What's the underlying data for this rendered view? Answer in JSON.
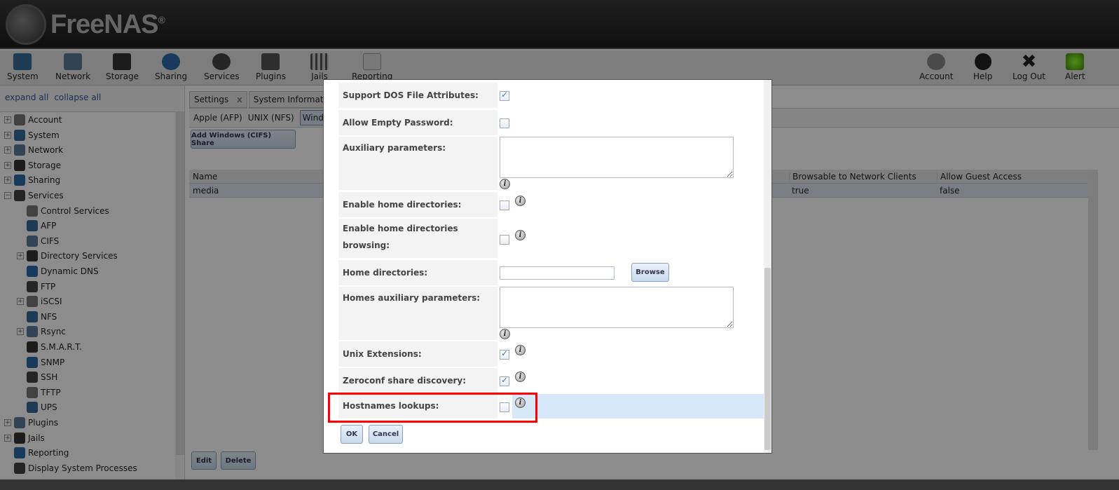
{
  "header": {
    "logo": "FreeNAS"
  },
  "toolbar": {
    "left": [
      "System",
      "Network",
      "Storage",
      "Sharing",
      "Services",
      "Plugins",
      "Jails",
      "Reporting"
    ],
    "right": [
      "Account",
      "Help",
      "Log Out",
      "Alert"
    ]
  },
  "sidebar": {
    "expand_all": "expand all",
    "collapse_all": "collapse all",
    "items": [
      {
        "label": "Account",
        "level": 0,
        "exp": true
      },
      {
        "label": "System",
        "level": 0,
        "exp": true
      },
      {
        "label": "Network",
        "level": 0,
        "exp": true
      },
      {
        "label": "Storage",
        "level": 0,
        "exp": true
      },
      {
        "label": "Sharing",
        "level": 0,
        "exp": true
      },
      {
        "label": "Services",
        "level": 0,
        "exp": true,
        "open": true
      },
      {
        "label": "Control Services",
        "level": 1
      },
      {
        "label": "AFP",
        "level": 1
      },
      {
        "label": "CIFS",
        "level": 1
      },
      {
        "label": "Directory Services",
        "level": 1,
        "exp": true
      },
      {
        "label": "Dynamic DNS",
        "level": 1
      },
      {
        "label": "FTP",
        "level": 1
      },
      {
        "label": "iSCSI",
        "level": 1,
        "exp": true
      },
      {
        "label": "NFS",
        "level": 1
      },
      {
        "label": "Rsync",
        "level": 1,
        "exp": true
      },
      {
        "label": "S.M.A.R.T.",
        "level": 1
      },
      {
        "label": "SNMP",
        "level": 1
      },
      {
        "label": "SSH",
        "level": 1
      },
      {
        "label": "TFTP",
        "level": 1
      },
      {
        "label": "UPS",
        "level": 1
      },
      {
        "label": "Plugins",
        "level": 0,
        "exp": true
      },
      {
        "label": "Jails",
        "level": 0,
        "exp": true
      },
      {
        "label": "Reporting",
        "level": 0
      },
      {
        "label": "Display System Processes",
        "level": 0
      }
    ]
  },
  "main": {
    "tabs": [
      "Settings",
      "System Information"
    ],
    "tab_close": "x",
    "subtabs": [
      "Apple (AFP)",
      "UNIX (NFS)",
      "Windows"
    ],
    "add_button": "Add Windows (CIFS) Share",
    "columns": [
      "Name",
      "Browsable to Network Clients",
      "Allow Guest Access"
    ],
    "rows": [
      [
        "media",
        "true",
        "false"
      ]
    ],
    "edit": "Edit",
    "delete": "Delete"
  },
  "dialog": {
    "support_dos": {
      "label": "Support DOS File Attributes:",
      "checked": true
    },
    "allow_empty": {
      "label": "Allow Empty Password:",
      "checked": false
    },
    "aux": {
      "label": "Auxiliary parameters:",
      "value": ""
    },
    "home_enable": {
      "label": "Enable home directories:",
      "checked": false
    },
    "home_browse": {
      "label": "Enable home directories browsing:",
      "checked": false
    },
    "home_dir": {
      "label": "Home directories:",
      "value": "",
      "browse": "Browse"
    },
    "homes_aux": {
      "label": "Homes auxiliary parameters:",
      "value": ""
    },
    "unix_ext": {
      "label": "Unix Extensions:",
      "checked": true
    },
    "zeroconf": {
      "label": "Zeroconf share discovery:",
      "checked": true
    },
    "hostnames": {
      "label": "Hostnames lookups:",
      "checked": false
    },
    "info_glyph": "i",
    "ok": "OK",
    "cancel": "Cancel"
  }
}
